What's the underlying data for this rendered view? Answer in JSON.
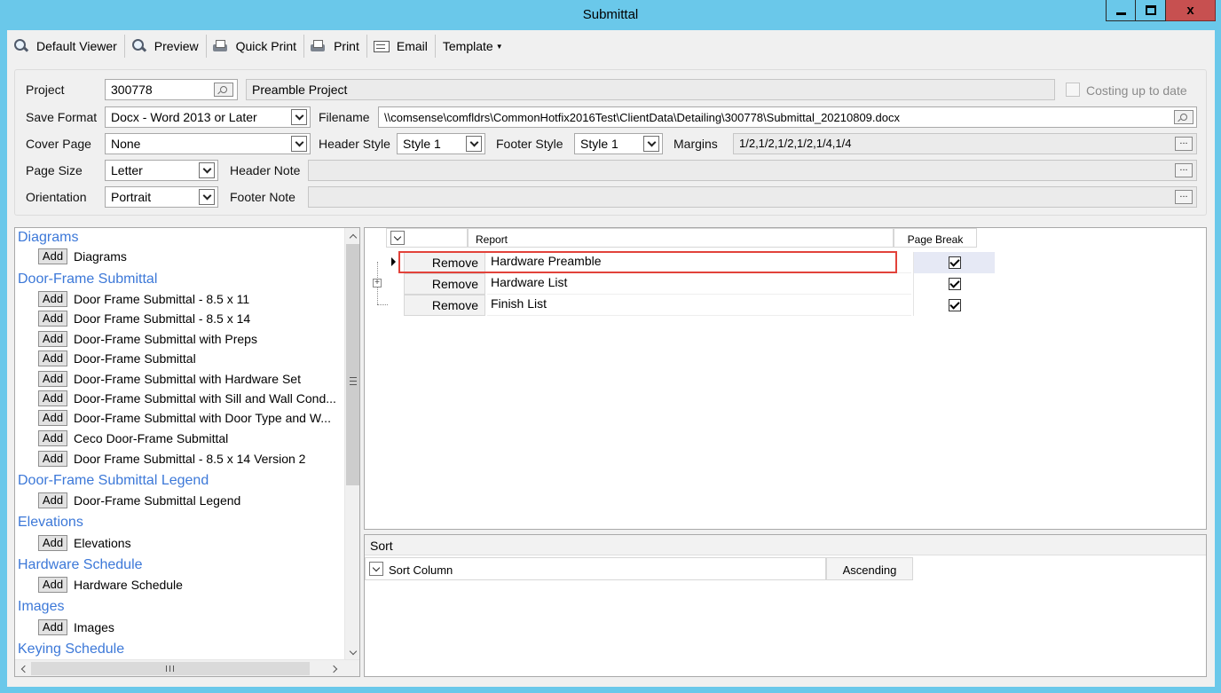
{
  "window": {
    "title": "Submittal"
  },
  "toolbar": {
    "default_viewer": "Default Viewer",
    "preview": "Preview",
    "quick_print": "Quick Print",
    "print": "Print",
    "email": "Email",
    "template": "Template"
  },
  "form": {
    "project_label": "Project",
    "project_number": "300778",
    "project_name": "Preamble Project",
    "costing_label": "Costing up to date",
    "save_format_label": "Save Format",
    "save_format_value": "Docx - Word 2013 or Later",
    "filename_label": "Filename",
    "filename_value": "\\\\comsense\\comfldrs\\CommonHotfix2016Test\\ClientData\\Detailing\\300778\\Submittal_20210809.docx",
    "cover_page_label": "Cover Page",
    "cover_page_value": "None",
    "header_style_label": "Header Style",
    "header_style_value": "Style 1",
    "footer_style_label": "Footer Style",
    "footer_style_value": "Style 1",
    "margins_label": "Margins",
    "margins_value": "1/2,1/2,1/2,1/2,1/4,1/4",
    "page_size_label": "Page Size",
    "page_size_value": "Letter",
    "header_note_label": "Header Note",
    "header_note_value": "",
    "orientation_label": "Orientation",
    "orientation_value": "Portrait",
    "footer_note_label": "Footer Note",
    "footer_note_value": "",
    "ellipsis": "..."
  },
  "library": {
    "add_label": "Add",
    "categories": [
      {
        "name": "Diagrams",
        "items": [
          "Diagrams"
        ]
      },
      {
        "name": "Door-Frame Submittal",
        "items": [
          "Door Frame Submittal - 8.5 x 11",
          "Door Frame Submittal - 8.5 x 14",
          "Door-Frame Submittal with Preps",
          "Door-Frame Submittal",
          "Door-Frame Submittal with Hardware Set",
          "Door-Frame Submittal with Sill and Wall Cond...",
          "Door-Frame Submittal with Door Type and W...",
          "Ceco Door-Frame Submittal",
          "Door Frame Submittal - 8.5 x 14 Version 2"
        ]
      },
      {
        "name": "Door-Frame Submittal Legend",
        "items": [
          "Door-Frame Submittal Legend"
        ]
      },
      {
        "name": "Elevations",
        "items": [
          "Elevations"
        ]
      },
      {
        "name": "Hardware Schedule",
        "items": [
          "Hardware Schedule"
        ]
      },
      {
        "name": "Images",
        "items": [
          "Images"
        ]
      },
      {
        "name": "Keying Schedule",
        "items": []
      }
    ],
    "hscroll_glyph": "III"
  },
  "reports": {
    "col_report": "Report",
    "col_page_break": "Page Break",
    "remove_label": "Remove",
    "rows": [
      {
        "name": "Hardware Preamble",
        "page_break": true
      },
      {
        "name": "Hardware List",
        "page_break": true
      },
      {
        "name": "Finish List",
        "page_break": true
      }
    ]
  },
  "sort": {
    "title": "Sort",
    "col_sort_column": "Sort Column",
    "col_ascending": "Ascending"
  }
}
